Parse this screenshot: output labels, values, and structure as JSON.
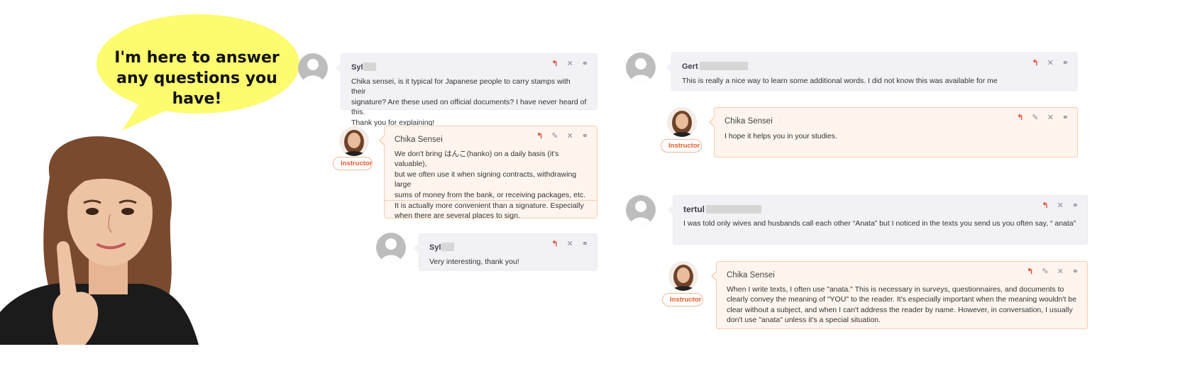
{
  "bubble": {
    "text": "I'm here to answer any questions you have!",
    "color": "#fdfb6e"
  },
  "colors": {
    "accent": "#e85b2b",
    "reply": "#e0493a",
    "student_bg": "#f2f2f6",
    "teacher_bg": "#fff5ee",
    "teacher_border": "#f6cdb0"
  },
  "icons": {
    "reply": "↰",
    "edit": "✎",
    "delete": "✕",
    "link": "⚭"
  },
  "badge_label": "Instructor",
  "threads": {
    "left": {
      "c1": {
        "author": "Syl",
        "text": "Chika sensei, is it typical for Japanese people to carry stamps with their\nsignature? Are these used on official documents? I have never heard of this.\nThank you for explaining!"
      },
      "r1": {
        "author": "Chika Sensei",
        "text": "We don't bring はんこ(hanko) on a daily basis (it's valuable),\nbut we often use it when signing contracts, withdrawing large\nsums of money from the bank, or receiving packages, etc.\nIt is actually more convenient than a signature. Especially\nwhen there are several places to sign."
      },
      "r2": {
        "author": "Syl",
        "text": "Very interesting, thank you!"
      }
    },
    "right": {
      "c1": {
        "author": "Gert",
        "text": "This is really a nice way to learn some additional words. I did not know this was available for me"
      },
      "r1": {
        "author": "Chika Sensei",
        "text": "I hope it helps you in your studies."
      },
      "c2": {
        "author": "tertul",
        "text": "I was told only wives and husbands call each other “Anata” but I noticed in the texts you send us you often say, “ anata”"
      },
      "r2": {
        "author": "Chika Sensei",
        "text": "When I write texts, I often use \"anata.\" This is necessary in surveys, questionnaires, and documents to\nclearly convey the meaning of \"YOU\" to the reader. It's especially important when the meaning wouldn't be\nclear without a subject, and when I can't address the reader by name. However, in conversation, I usually\ndon't use \"anata\" unless it's a special situation."
      }
    }
  }
}
